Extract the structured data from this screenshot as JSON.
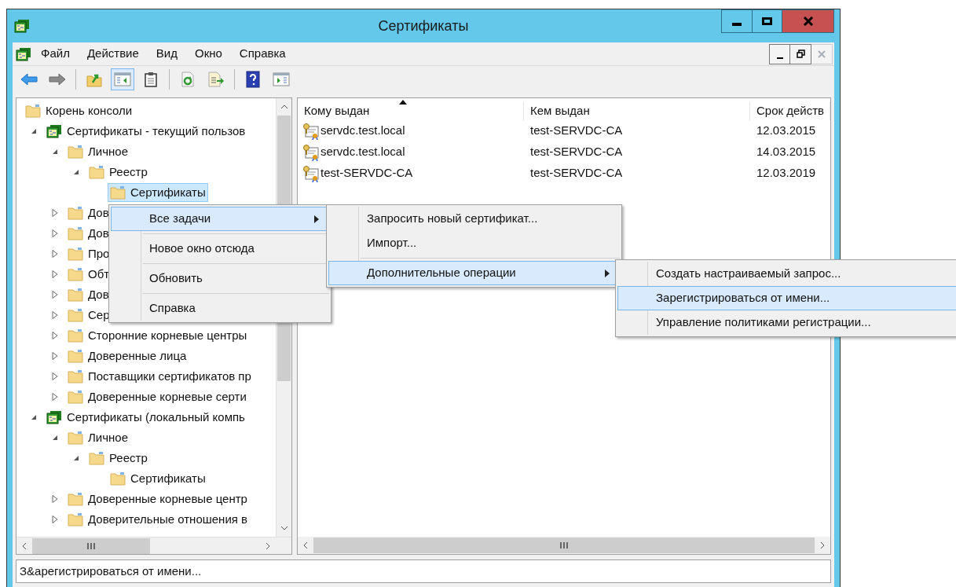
{
  "window": {
    "title": "Сертификаты"
  },
  "menu_bar": [
    "Файл",
    "Действие",
    "Вид",
    "Окно",
    "Справка"
  ],
  "toolbar": [
    [
      {
        "kind": "back",
        "pressed": false
      },
      {
        "kind": "forward",
        "pressed": false
      }
    ],
    [
      {
        "kind": "up",
        "pressed": false
      },
      {
        "kind": "tree",
        "pressed": true
      },
      {
        "kind": "clipboard",
        "pressed": false
      }
    ],
    [
      {
        "kind": "refresh",
        "pressed": false
      },
      {
        "kind": "export",
        "pressed": false
      }
    ],
    [
      {
        "kind": "help",
        "pressed": false
      },
      {
        "kind": "panel",
        "pressed": false
      }
    ]
  ],
  "tree": [
    {
      "label": "Корень консоли",
      "kind": "folder",
      "selected": false,
      "children": [
        {
          "label": "Сертификаты - текущий пользов",
          "kind": "snapin",
          "expanded": true,
          "selected": false,
          "children": [
            {
              "label": "Личное",
              "kind": "folder",
              "expanded": true,
              "selected": false,
              "children": [
                {
                  "label": "Реестр",
                  "kind": "folder",
                  "expanded": true,
                  "selected": false,
                  "children": [
                    {
                      "label": "Сертификаты",
                      "kind": "folder",
                      "selected": true
                    }
                  ]
                }
              ]
            },
            {
              "label": "Дов",
              "kind": "folder",
              "expanded": false,
              "selected": false
            },
            {
              "label": "Дов",
              "kind": "folder",
              "expanded": false,
              "selected": false
            },
            {
              "label": "Про",
              "kind": "folder",
              "expanded": false,
              "selected": false
            },
            {
              "label": "Обт",
              "kind": "folder",
              "expanded": false,
              "selected": false
            },
            {
              "label": "Дов",
              "kind": "folder",
              "expanded": false,
              "selected": false
            },
            {
              "label": "Сер",
              "kind": "folder",
              "expanded": false,
              "selected": false
            },
            {
              "label": "Сторонние корневые центры",
              "kind": "folder",
              "expanded": false,
              "selected": false
            },
            {
              "label": "Доверенные лица",
              "kind": "folder",
              "expanded": false,
              "selected": false
            },
            {
              "label": "Поставщики сертификатов пр",
              "kind": "folder",
              "expanded": false,
              "selected": false
            },
            {
              "label": "Доверенные корневые серти",
              "kind": "folder",
              "expanded": false,
              "selected": false
            }
          ]
        },
        {
          "label": "Сертификаты (локальный компь",
          "kind": "snapin",
          "expanded": true,
          "selected": false,
          "children": [
            {
              "label": "Личное",
              "kind": "folder",
              "expanded": true,
              "selected": false,
              "children": [
                {
                  "label": "Реестр",
                  "kind": "folder",
                  "expanded": true,
                  "selected": false,
                  "children": [
                    {
                      "label": "Сертификаты",
                      "kind": "folder",
                      "selected": false
                    }
                  ]
                }
              ]
            },
            {
              "label": "Доверенные корневые центр",
              "kind": "folder",
              "expanded": false,
              "selected": false
            },
            {
              "label": "Доверительные отношения в",
              "kind": "folder",
              "expanded": false,
              "selected": false
            }
          ]
        }
      ]
    }
  ],
  "table": {
    "columns": [
      {
        "label": "Кому выдан",
        "sorted": true
      },
      {
        "label": "Кем выдан",
        "sorted": false
      },
      {
        "label": "Срок действ",
        "sorted": false
      }
    ],
    "rows": [
      [
        "servdc.test.local",
        "test-SERVDC-CA",
        "12.03.2015"
      ],
      [
        "servdc.test.local",
        "test-SERVDC-CA",
        "14.03.2015"
      ],
      [
        "test-SERVDC-CA",
        "test-SERVDC-CA",
        "12.03.2019"
      ]
    ]
  },
  "context_menus": [
    {
      "items": [
        {
          "label": "Все задачи",
          "selected": true,
          "submenu": true,
          "separator_before": false
        },
        {
          "label": "Новое окно отсюда",
          "selected": false,
          "submenu": false,
          "separator_before": true
        },
        {
          "label": "Обновить",
          "selected": false,
          "submenu": false,
          "separator_before": true
        },
        {
          "label": "Справка",
          "selected": false,
          "submenu": false,
          "separator_before": true
        }
      ]
    },
    {
      "items": [
        {
          "label": "Запросить новый сертификат...",
          "selected": false,
          "submenu": false,
          "separator_before": false
        },
        {
          "label": "Импорт...",
          "selected": false,
          "submenu": false,
          "separator_before": false
        },
        {
          "label": "Дополнительные операции",
          "selected": true,
          "submenu": true,
          "separator_before": true
        }
      ]
    },
    {
      "items": [
        {
          "label": "Создать настраиваемый запрос...",
          "selected": false,
          "submenu": false,
          "separator_before": false
        },
        {
          "label": "Зарегистрироваться от имени...",
          "selected": true,
          "submenu": false,
          "separator_before": false
        },
        {
          "label": "Управление политиками регистрации...",
          "selected": false,
          "submenu": false,
          "separator_before": false
        }
      ]
    }
  ],
  "status_bar": "З&арегистрироваться от имени..."
}
